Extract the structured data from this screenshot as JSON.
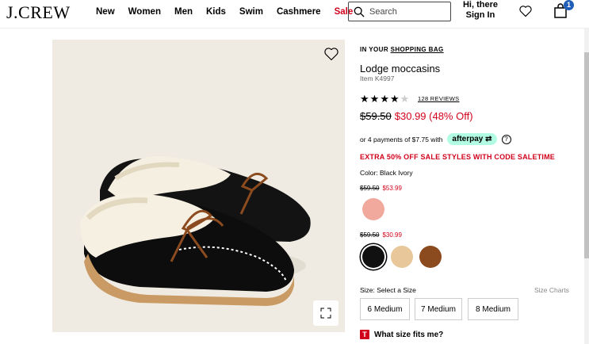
{
  "header": {
    "logo": "J.CREW",
    "nav": [
      "New",
      "Women",
      "Men",
      "Kids",
      "Swim",
      "Cashmere",
      "Sale"
    ],
    "search_placeholder": "Search",
    "greeting_line1": "Hi, there",
    "greeting_line2": "Sign In",
    "bag_count": "1"
  },
  "product": {
    "in_bag_prefix": "IN YOUR ",
    "in_bag_link": "SHOPPING BAG",
    "title": "Lodge moccasins",
    "item_number": "Item K4997",
    "rating": 4,
    "rating_max": 5,
    "reviews": "128 REVIEWS",
    "price_old": "$59.50",
    "price_now": "$30.99 (48% Off)",
    "afterpay_text": "or 4 payments of $7.75 with",
    "afterpay_badge": "afterpay",
    "help_icon": "?",
    "promo": "EXTRA 50% OFF SALE STYLES WITH CODE SALETIME",
    "color_label": "Color: Black Ivory",
    "price_group1_old": "$59.50",
    "price_group1_now": "$53.99",
    "price_group2_old": "$59.50",
    "price_group2_now": "$30.99",
    "swatch_colors": {
      "pink": "#f0a99c",
      "black": "#111111",
      "tan": "#e8c79a",
      "brown": "#8b4b1f"
    },
    "size_label": "Size:  Select a Size",
    "size_charts": "Size Charts",
    "sizes": [
      "6 Medium",
      "7 Medium",
      "8 Medium"
    ],
    "fit_icon": "T",
    "fit_text": "What size fits me?"
  },
  "colors": {
    "sale_red": "#d0021b",
    "image_bg": "#efebe2",
    "afterpay_mint": "#b2fce4",
    "bag_badge_blue": "#1f5fb8"
  }
}
